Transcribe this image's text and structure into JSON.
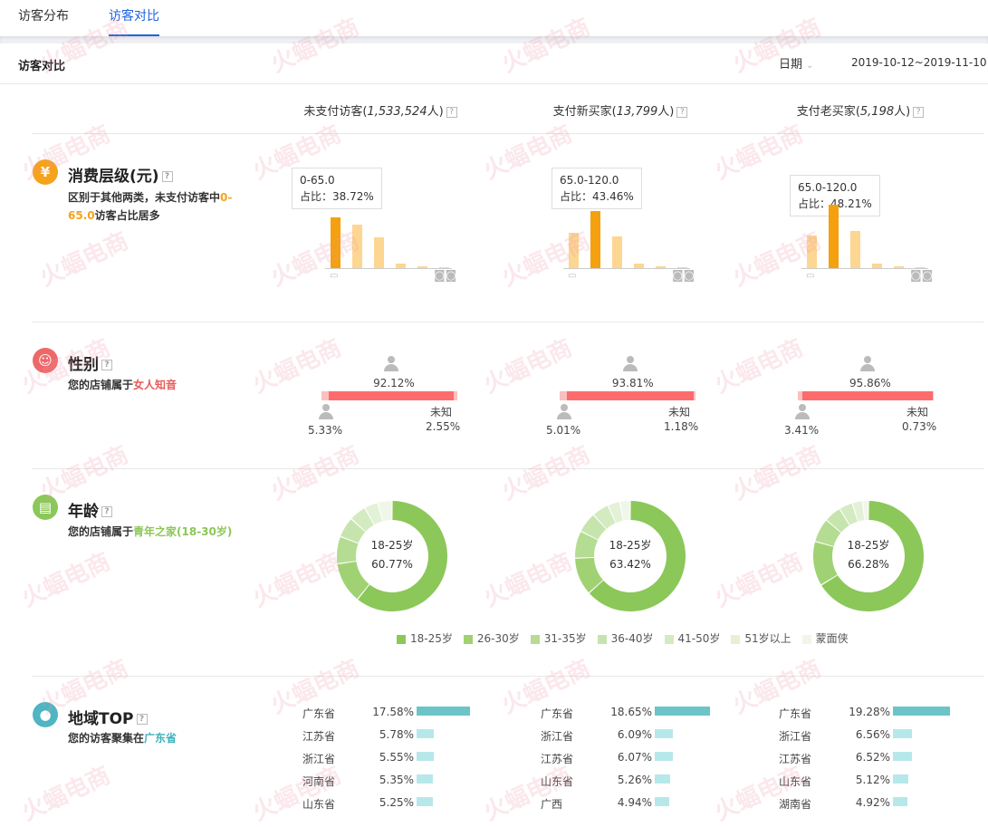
{
  "tabs": [
    {
      "label": "访客分布",
      "active": false
    },
    {
      "label": "访客对比",
      "active": true
    }
  ],
  "panel": {
    "title": "访客对比",
    "date_label": "日期",
    "date_range": "2019-10-12~2019-11-10"
  },
  "columns": [
    {
      "name": "未支付访客",
      "count": "1,533,524"
    },
    {
      "name": "支付新买家",
      "count": "13,799"
    },
    {
      "name": "支付老买家",
      "count": "5,198"
    }
  ],
  "spending": {
    "title": "消费层级(元)",
    "desc_prefix": "区别于其他两类，未支付访客中",
    "desc_highlight": "0-65.0",
    "desc_suffix": "访客占比居多",
    "tooltip_prefix": "占比：",
    "charts": [
      {
        "range": "0-65.0",
        "ratio": "38.72%",
        "values": [
          38.72,
          33,
          23.5,
          3.5,
          1.2,
          0.8
        ],
        "highlight_index": 0
      },
      {
        "range": "65.0-120.0",
        "ratio": "43.46%",
        "values": [
          27,
          43.46,
          24,
          3.5,
          1.3,
          0.8
        ],
        "highlight_index": 1
      },
      {
        "range": "65.0-120.0",
        "ratio": "48.21%",
        "values": [
          24.5,
          48.21,
          28.5,
          3.5,
          1.2,
          0.8
        ],
        "highlight_index": 1
      }
    ]
  },
  "gender": {
    "title": "性别",
    "desc_prefix": "您的店铺属于",
    "desc_highlight": "女人知音",
    "unknown_label": "未知",
    "columns": [
      {
        "female": "92.12%",
        "male": "5.33%",
        "unknown": "2.55%",
        "female_val": 92.12,
        "male_val": 5.33,
        "unknown_val": 2.55
      },
      {
        "female": "93.81%",
        "male": "5.01%",
        "unknown": "1.18%",
        "female_val": 93.81,
        "male_val": 5.01,
        "unknown_val": 1.18
      },
      {
        "female": "95.86%",
        "male": "3.41%",
        "unknown": "0.73%",
        "female_val": 95.86,
        "male_val": 3.41,
        "unknown_val": 0.73
      }
    ]
  },
  "age": {
    "title": "年龄",
    "desc_prefix": "您的店铺属于",
    "desc_highlight": "青年之家(18-30岁)",
    "legend": [
      "18-25岁",
      "26-30岁",
      "31-35岁",
      "36-40岁",
      "41-50岁",
      "51岁以上",
      "蒙面侠"
    ],
    "colors": [
      "#8cc759",
      "#a0d274",
      "#b4dc92",
      "#c6e4ad",
      "#d4ebc1",
      "#e3f1d6",
      "#f0f7ea"
    ],
    "charts": [
      {
        "label": "18-25岁",
        "value": "60.77%",
        "slices": [
          60.77,
          12,
          8,
          6,
          5,
          4,
          4.23
        ]
      },
      {
        "label": "18-25岁",
        "value": "63.42%",
        "slices": [
          63.42,
          11,
          8,
          6,
          5,
          3.5,
          3.08
        ]
      },
      {
        "label": "18-25岁",
        "value": "66.28%",
        "slices": [
          66.28,
          13,
          7,
          5,
          4,
          3,
          1.72
        ]
      }
    ]
  },
  "region": {
    "title": "地域TOP",
    "desc_prefix": "您的访客聚集在",
    "desc_highlight": "广东省",
    "columns": [
      [
        {
          "name": "广东省",
          "value": "17.58%",
          "v": 17.58
        },
        {
          "name": "江苏省",
          "value": "5.78%",
          "v": 5.78
        },
        {
          "name": "浙江省",
          "value": "5.55%",
          "v": 5.55
        },
        {
          "name": "河南省",
          "value": "5.35%",
          "v": 5.35
        },
        {
          "name": "山东省",
          "value": "5.25%",
          "v": 5.25
        }
      ],
      [
        {
          "name": "广东省",
          "value": "18.65%",
          "v": 18.65
        },
        {
          "name": "浙江省",
          "value": "6.09%",
          "v": 6.09
        },
        {
          "name": "江苏省",
          "value": "6.07%",
          "v": 6.07
        },
        {
          "name": "山东省",
          "value": "5.26%",
          "v": 5.26
        },
        {
          "name": "广西",
          "value": "4.94%",
          "v": 4.94
        }
      ],
      [
        {
          "name": "广东省",
          "value": "19.28%",
          "v": 19.28
        },
        {
          "name": "浙江省",
          "value": "6.56%",
          "v": 6.56
        },
        {
          "name": "江苏省",
          "value": "6.52%",
          "v": 6.52
        },
        {
          "name": "山东省",
          "value": "5.12%",
          "v": 5.12
        },
        {
          "name": "湖南省",
          "value": "4.92%",
          "v": 4.92
        }
      ]
    ]
  },
  "watermark": "火蝠电商"
}
